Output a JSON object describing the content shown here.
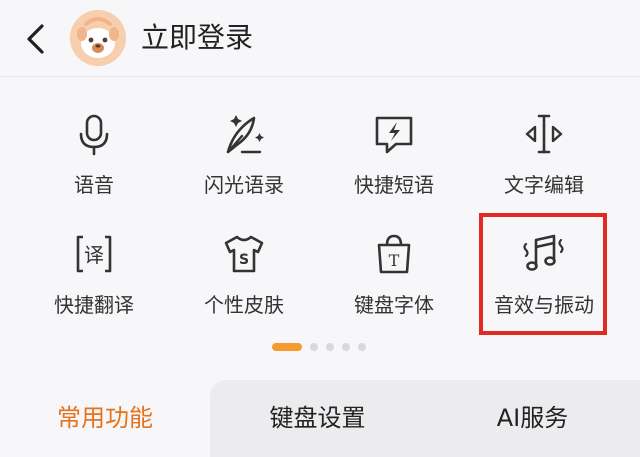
{
  "header": {
    "login_label": "立即登录"
  },
  "functions": [
    {
      "label": "语音",
      "icon": "microphone-icon"
    },
    {
      "label": "闪光语录",
      "icon": "feather-sparkle-icon"
    },
    {
      "label": "快捷短语",
      "icon": "lightning-bubble-icon"
    },
    {
      "label": "文字编辑",
      "icon": "cursor-edit-icon"
    },
    {
      "label": "快捷翻译",
      "icon": "translate-icon"
    },
    {
      "label": "个性皮肤",
      "icon": "tshirt-icon"
    },
    {
      "label": "键盘字体",
      "icon": "font-bag-icon"
    },
    {
      "label": "音效与振动",
      "icon": "music-vibrate-icon"
    }
  ],
  "pager": {
    "page_count": 5,
    "active_index": 0
  },
  "tabs": [
    {
      "label": "常用功能",
      "active": true
    },
    {
      "label": "键盘设置",
      "active": false
    },
    {
      "label": "AI服务",
      "active": false
    }
  ],
  "colors": {
    "accent": "#e5731b",
    "highlight": "#e22a22",
    "dot_active": "#f59a2e"
  }
}
